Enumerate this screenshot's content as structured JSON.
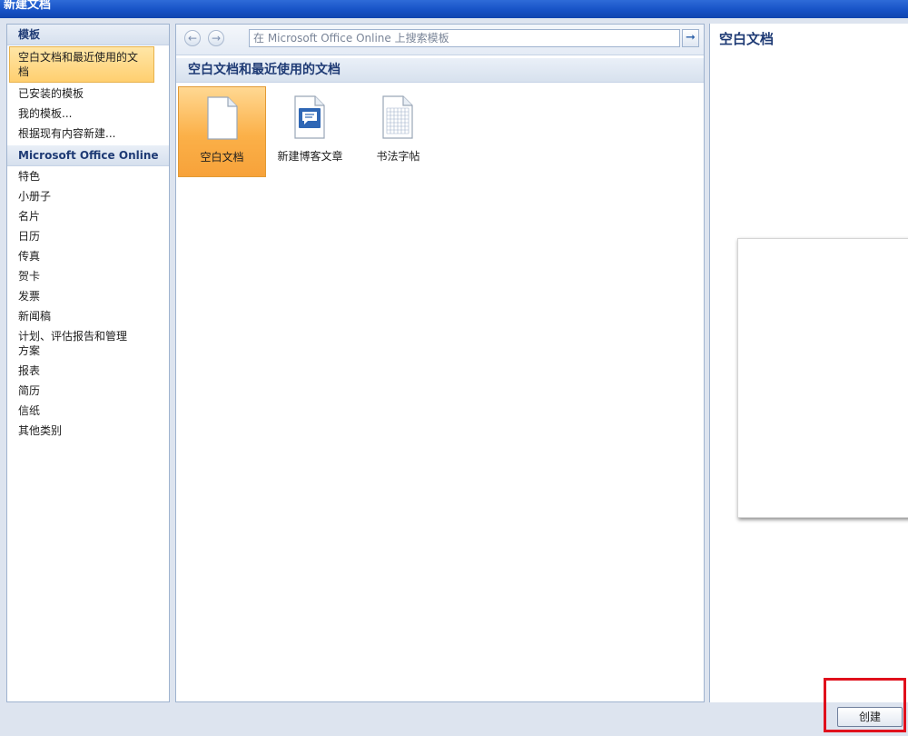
{
  "window": {
    "title": "新建文档"
  },
  "left_pane": {
    "templates_header": "模板",
    "items": [
      {
        "label": "空白文档和最近使用的文档",
        "selected": true
      },
      {
        "label": "已安装的模板"
      },
      {
        "label": "我的模板..."
      },
      {
        "label": "根据现有内容新建..."
      }
    ],
    "online_header": "Microsoft Office Online",
    "online_items": [
      {
        "label": "特色"
      },
      {
        "label": "小册子"
      },
      {
        "label": "名片"
      },
      {
        "label": "日历"
      },
      {
        "label": "传真"
      },
      {
        "label": "贺卡"
      },
      {
        "label": "发票"
      },
      {
        "label": "新闻稿"
      },
      {
        "label": "计划、评估报告和管理方案"
      },
      {
        "label": "报表"
      },
      {
        "label": "简历"
      },
      {
        "label": "信纸"
      },
      {
        "label": "其他类别"
      }
    ]
  },
  "center_pane": {
    "search_placeholder": "在 Microsoft Office Online 上搜索模板",
    "header": "空白文档和最近使用的文档",
    "tiles": [
      {
        "label": "空白文档",
        "icon": "blank-document-icon",
        "selected": true
      },
      {
        "label": "新建博客文章",
        "icon": "blog-post-icon"
      },
      {
        "label": "书法字帖",
        "icon": "calligraphy-grid-icon"
      }
    ]
  },
  "right_pane": {
    "title": "空白文档"
  },
  "buttons": {
    "create": "创建"
  },
  "colors": {
    "selection": "#ffcf70",
    "highlight_box": "#e0101c",
    "title_bar": "#1550c4"
  }
}
